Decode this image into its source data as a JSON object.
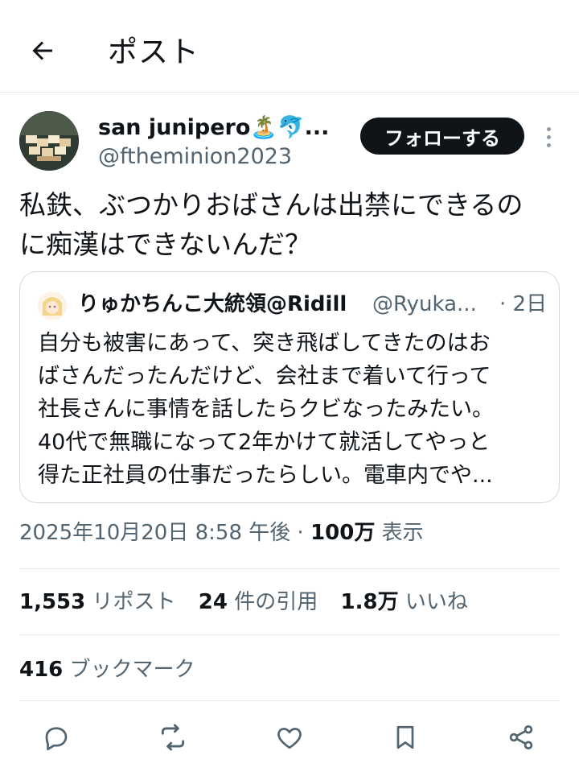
{
  "header": {
    "title": "ポスト"
  },
  "author": {
    "name": "san junipero🏝️🐬...",
    "handle": "@ftheminion2023",
    "follow_label": "フォローする"
  },
  "post": {
    "text_line1": "私鉄、ぶつかりおばさんは出禁にできるの",
    "text_line2": "に痴漢はできないんだ？"
  },
  "quote": {
    "name": "りゅかちんこ大統領@Ridill",
    "handle": "@Ryuka...",
    "time": "· 2日",
    "lines": [
      "自分も被害にあって、突き飛ばしてきたのはお",
      "ばさんだったんだけど、会社まで着いて行って",
      "社長さんに事情を話したらクビなったみたい。",
      "40代で無職になって2年かけて就活してやっと",
      "得た正社員の仕事だったらしい。電車内でや..."
    ]
  },
  "meta": {
    "datetime": "2025年10月20日 8:58 午後",
    "separator": "·",
    "views_count": "100万",
    "views_label": "表示"
  },
  "stats": {
    "reposts_count": "1,553",
    "reposts_label": "リポスト",
    "quotes_count": "24",
    "quotes_label": "件の引用",
    "likes_count": "1.8万",
    "likes_label": "いいね",
    "bookmarks_count": "416",
    "bookmarks_label": "ブックマーク"
  },
  "icons": {
    "back": "arrow-left-icon",
    "more": "more-vertical-icon",
    "reply": "reply-icon",
    "repost": "repost-icon",
    "like": "heart-icon",
    "bookmark": "bookmark-icon",
    "share": "share-icon"
  },
  "colors": {
    "text": "#0f1419",
    "secondary": "#536471",
    "border": "#cfd9de",
    "button_bg": "#0f1419"
  }
}
